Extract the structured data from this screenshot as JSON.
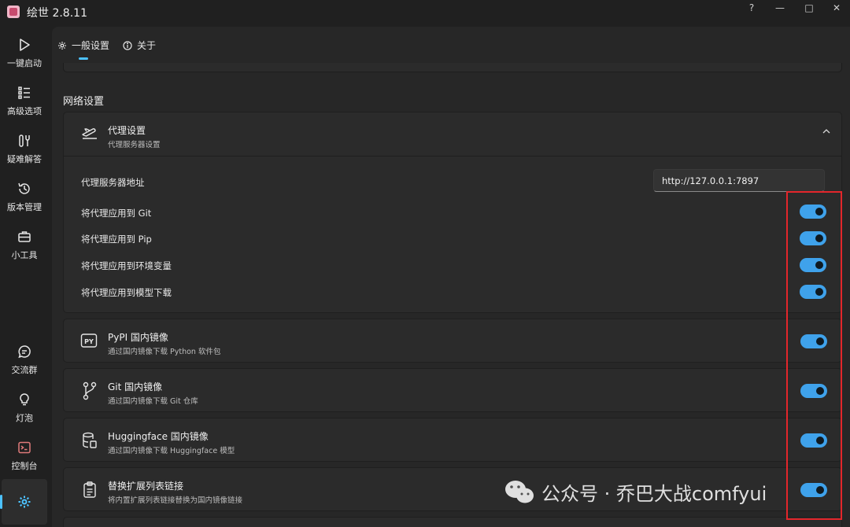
{
  "window": {
    "title": "绘世 2.8.11",
    "help": "?",
    "minimize": "—",
    "maximize": "□",
    "close": "✕"
  },
  "sidebar": {
    "items": [
      {
        "label": "一键启动",
        "icon": "play-icon"
      },
      {
        "label": "高级选项",
        "icon": "list-icon"
      },
      {
        "label": "疑难解答",
        "icon": "tools-icon"
      },
      {
        "label": "版本管理",
        "icon": "history-icon"
      },
      {
        "label": "小工具",
        "icon": "toolbox-icon"
      },
      {
        "label": "交流群",
        "icon": "chat-icon"
      },
      {
        "label": "灯泡",
        "icon": "lightbulb-icon"
      },
      {
        "label": "控制台",
        "icon": "console-icon"
      }
    ],
    "settings_icon": "gear-icon"
  },
  "tabs": [
    {
      "label": "一般设置",
      "icon": "gear-icon",
      "active": true
    },
    {
      "label": "关于",
      "icon": "info-icon",
      "active": false
    }
  ],
  "network": {
    "section_title": "网络设置",
    "proxy": {
      "title": "代理设置",
      "subtitle": "代理服务器设置",
      "address_label": "代理服务器地址",
      "address_value": "http://127.0.0.1:7897",
      "toggles": [
        {
          "label": "将代理应用到 Git",
          "on": true
        },
        {
          "label": "将代理应用到 Pip",
          "on": true
        },
        {
          "label": "将代理应用到环境变量",
          "on": true
        },
        {
          "label": "将代理应用到模型下载",
          "on": true
        }
      ]
    },
    "mirrors": [
      {
        "title": "PyPI 国内镜像",
        "subtitle": "通过国内镜像下载 Python 软件包",
        "icon": "pypi-icon",
        "on": true
      },
      {
        "title": "Git 国内镜像",
        "subtitle": "通过国内镜像下载 Git 仓库",
        "icon": "git-branch-icon",
        "on": true
      },
      {
        "title": "Huggingface 国内镜像",
        "subtitle": "通过国内镜像下载 Huggingface 模型",
        "icon": "database-icon",
        "on": true
      },
      {
        "title": "替换扩展列表链接",
        "subtitle": "将内置扩展列表链接替换为国内镜像链接",
        "icon": "clipboard-icon",
        "on": true
      }
    ]
  },
  "watermark": {
    "text": "公众号 · 乔巴大战comfyui"
  },
  "colors": {
    "accent": "#3fa2eb",
    "highlight": "#e3262b",
    "background": "#202020"
  }
}
